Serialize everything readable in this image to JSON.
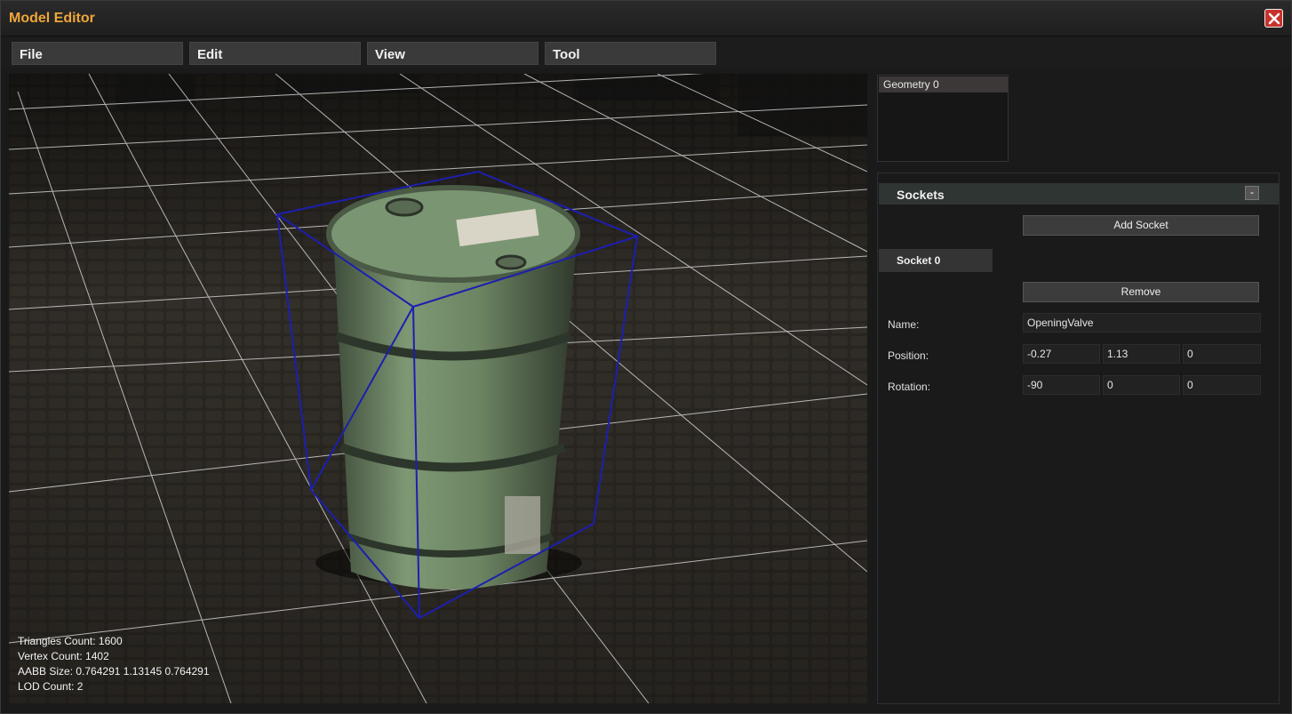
{
  "window": {
    "title": "Model Editor"
  },
  "menu": {
    "items": [
      "File",
      "Edit",
      "View",
      "Tool"
    ]
  },
  "stats": {
    "triangles": "Triangles Count: 1600",
    "vertices": "Vertex Count: 1402",
    "aabb": "AABB Size: 0.764291 1.13145 0.764291",
    "lod": "LOD Count: 2"
  },
  "geometry": {
    "items": [
      "Geometry 0"
    ]
  },
  "sockets": {
    "title": "Sockets",
    "collapse_label": "-",
    "add_label": "Add Socket",
    "socket_tab": "Socket 0",
    "remove_label": "Remove",
    "name_label": "Name:",
    "name_value": "OpeningValve",
    "position_label": "Position:",
    "position": [
      "-0.27",
      "1.13",
      "0"
    ],
    "rotation_label": "Rotation:",
    "rotation": [
      "-90",
      "0",
      "0"
    ]
  },
  "colors": {
    "accent": "#f0a63a",
    "close": "#c8322b",
    "bbox": "#1c1fb0",
    "barrel": "#6f8a68"
  }
}
